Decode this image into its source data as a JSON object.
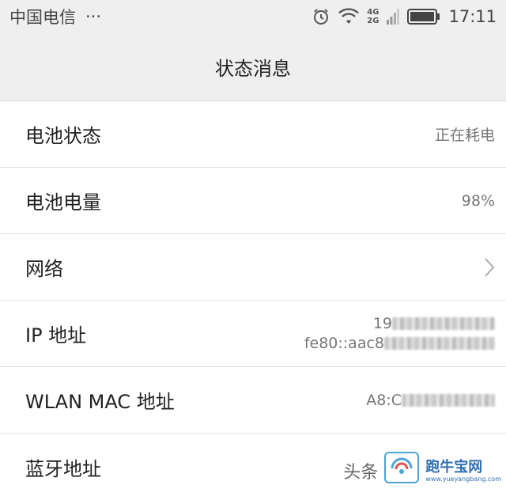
{
  "status_bar": {
    "carrier": "中国电信",
    "more": "···",
    "net_top": "4G",
    "net_bottom": "2G",
    "time": "17:11"
  },
  "header": {
    "title": "状态消息"
  },
  "rows": [
    {
      "label": "电池状态",
      "value": "正在耗电"
    },
    {
      "label": "电池电量",
      "value": "98%"
    },
    {
      "label": "网络"
    },
    {
      "label": "IP 地址",
      "value_line1_prefix": "19",
      "value_line2_prefix": "fe80::aac8"
    },
    {
      "label": "WLAN MAC 地址",
      "value_prefix": "A8:C"
    },
    {
      "label": "蓝牙地址"
    }
  ],
  "watermark": {
    "source": "头条",
    "brand": "跑牛宝网",
    "url": "www.yueyangbang.com"
  },
  "colors": {
    "bar_bg": "#efefef",
    "accent": "#1a5fa8"
  }
}
